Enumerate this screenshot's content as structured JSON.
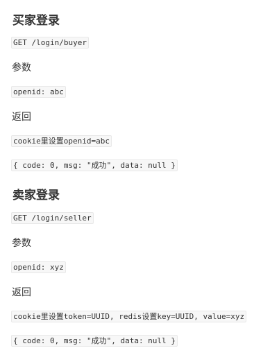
{
  "buyer": {
    "title": "买家登录",
    "endpoint": "GET /login/buyer",
    "params_label": "参数",
    "params": "openid: abc",
    "return_label": "返回",
    "return_note": "cookie里设置openid=abc",
    "response": "{ code: 0, msg: \"成功\", data: null }"
  },
  "seller": {
    "title": "卖家登录",
    "endpoint": "GET /login/seller",
    "params_label": "参数",
    "params": "openid: xyz",
    "return_label": "返回",
    "return_note": "cookie里设置token=UUID, redis设置key=UUID, value=xyz",
    "response": "{ code: 0, msg: \"成功\", data: null }"
  }
}
